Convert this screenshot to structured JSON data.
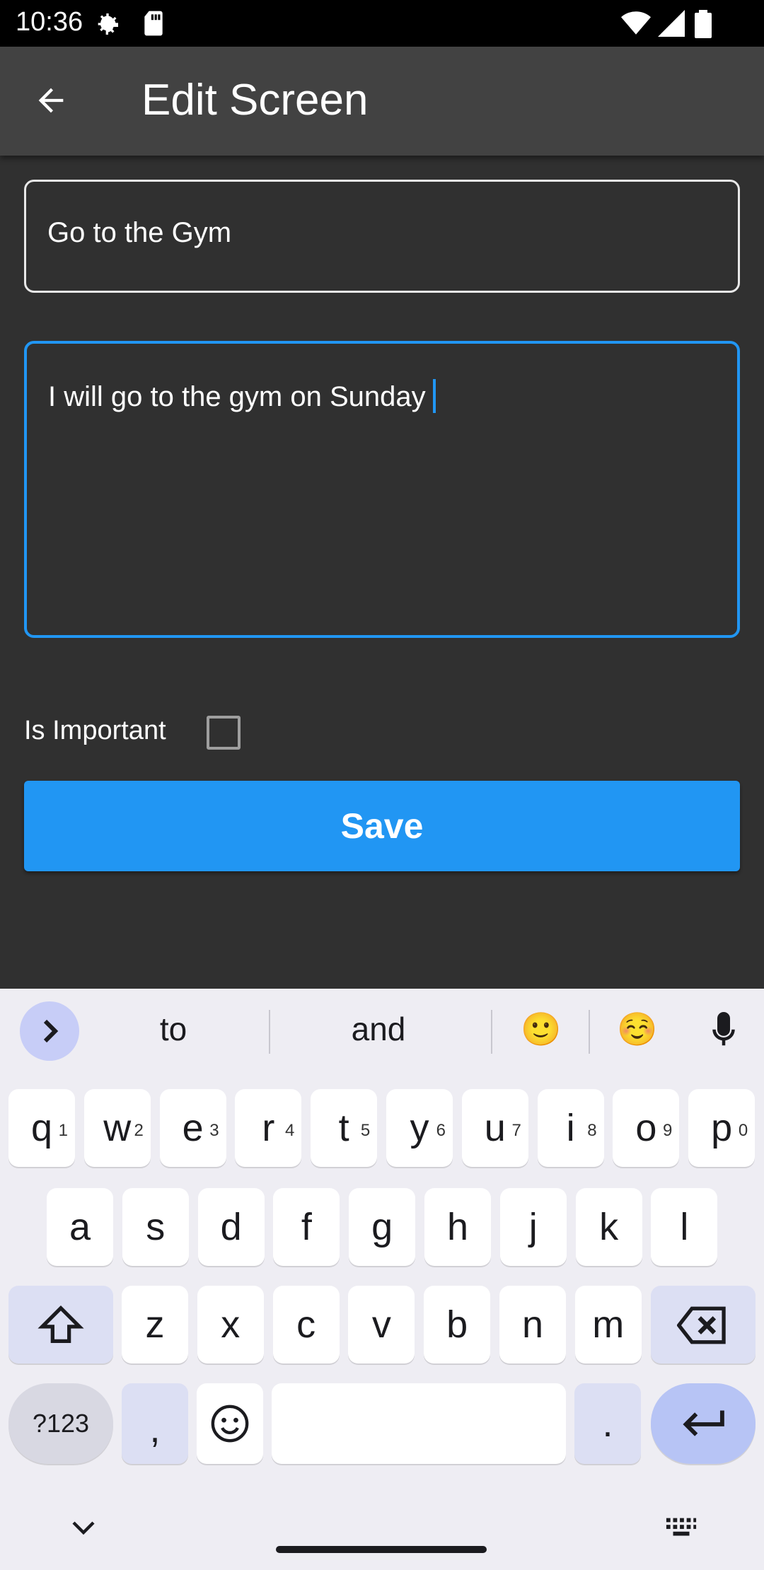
{
  "status_bar": {
    "time": "10:36",
    "icons": [
      "settings-icon",
      "sd-card-icon",
      "wifi-icon",
      "signal-icon",
      "battery-icon"
    ]
  },
  "app_bar": {
    "title": "Edit Screen",
    "back_icon": "arrow-back-icon"
  },
  "form": {
    "title_value": "Go to the Gym",
    "body_value": "I will go to the gym on Sunday",
    "important_label": "Is Important",
    "important_checked": false,
    "save_label": "Save"
  },
  "keyboard": {
    "suggestions": [
      "to",
      "and",
      "🙂",
      "☺️"
    ],
    "row1": [
      {
        "key": "q",
        "hint": "1"
      },
      {
        "key": "w",
        "hint": "2"
      },
      {
        "key": "e",
        "hint": "3"
      },
      {
        "key": "r",
        "hint": "4"
      },
      {
        "key": "t",
        "hint": "5"
      },
      {
        "key": "y",
        "hint": "6"
      },
      {
        "key": "u",
        "hint": "7"
      },
      {
        "key": "i",
        "hint": "8"
      },
      {
        "key": "o",
        "hint": "9"
      },
      {
        "key": "p",
        "hint": "0"
      }
    ],
    "row2": [
      "a",
      "s",
      "d",
      "f",
      "g",
      "h",
      "j",
      "k",
      "l"
    ],
    "row3": [
      "z",
      "x",
      "c",
      "v",
      "b",
      "n",
      "m"
    ],
    "sym_label": "?123",
    "comma": ",",
    "period": "."
  },
  "colors": {
    "accent": "#2196f3",
    "background": "#303030",
    "appbar": "#424242"
  }
}
